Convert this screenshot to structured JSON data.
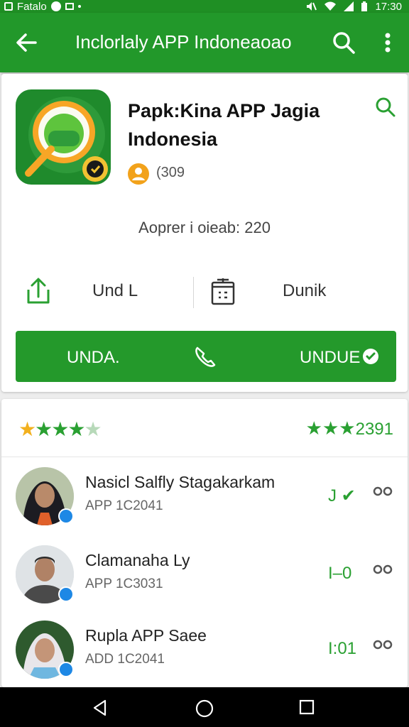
{
  "status_bar": {
    "carrier": "Fatalo",
    "time": "17:30"
  },
  "app_bar": {
    "back_icon": "arrow-left-icon",
    "title": "Inclorlaly APP Indoneaoao",
    "search_icon": "search-icon",
    "more_icon": "more-vert-icon"
  },
  "app": {
    "name": "Papk:Kina APP Jagia Indonesia",
    "developer_count": "(309",
    "appreciation": "Aoprer i oieab: 220",
    "colors": {
      "primary": "#22982a",
      "accent_gold": "#f2a21b"
    }
  },
  "actions": {
    "share_label": "Und L",
    "share_icon": "share-upload-icon",
    "info_label": "Dunik",
    "info_icon": "info-box-icon"
  },
  "install_bar": {
    "left_label": "UNDA.",
    "right_label": "UNDUE",
    "middle_icon": "call-icon",
    "check_icon": "check-circle-icon"
  },
  "rating": {
    "stars_left": 4.5,
    "summary": "2391"
  },
  "reviews": [
    {
      "name": "Nasicl Salfly Stagakarkam",
      "meta": "APP 1C2041",
      "score": "J ✔",
      "avatar": "woman-hijab-avatar"
    },
    {
      "name": "Clamanaha Ly",
      "meta": "APP 1C3031",
      "score": "I–0",
      "avatar": "man-avatar"
    },
    {
      "name": "Rupla APP Saee",
      "meta": "ADD 1C2041",
      "score": "I:01",
      "avatar": "woman-hijab-avatar"
    }
  ],
  "nav_bar": {
    "back": "nav-back-icon",
    "home": "nav-home-icon",
    "recent": "nav-recent-icon"
  }
}
